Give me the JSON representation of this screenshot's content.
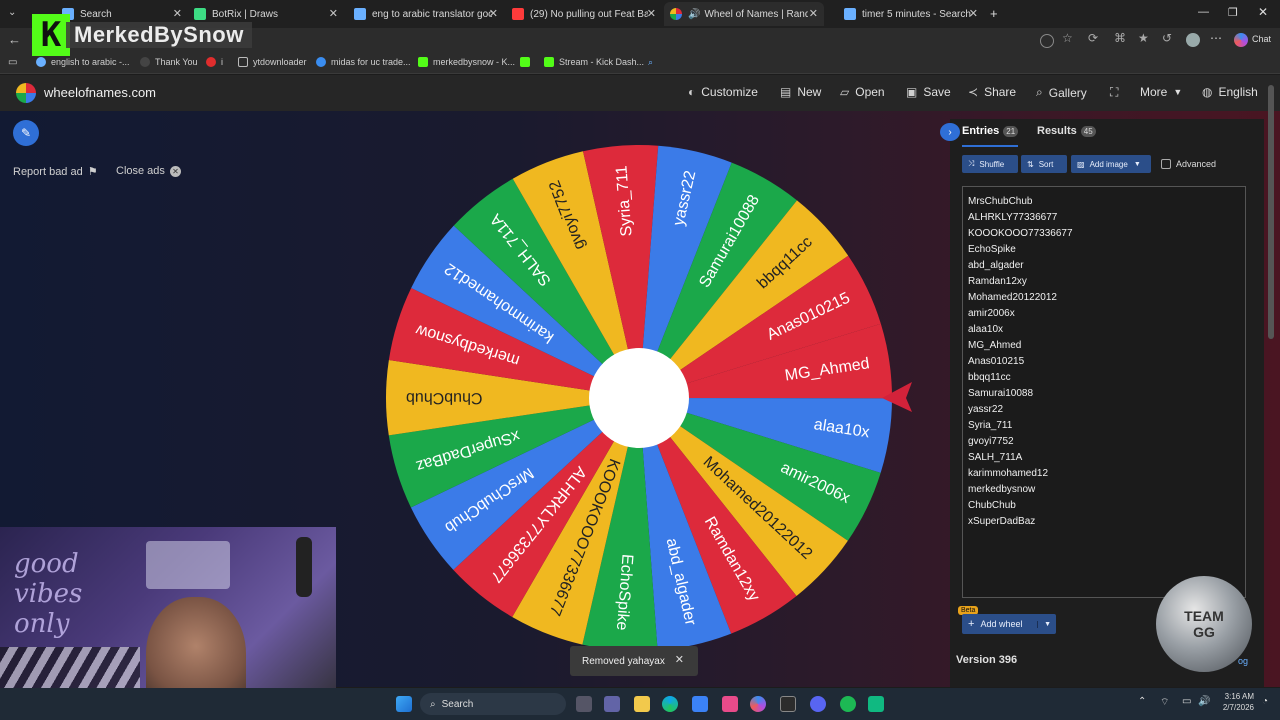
{
  "tabs": [
    {
      "label": "Search",
      "color": "#6ab0ff"
    },
    {
      "label": "BotRix | Draws",
      "color": "#3ddc84"
    },
    {
      "label": "eng to arabic translator google - S",
      "color": "#6ab0ff"
    },
    {
      "label": "(29) No pulling out Feat Baz",
      "color": "#ff3b3b"
    },
    {
      "label": "Wheel of Names | Random n",
      "color": "#4a8df6"
    },
    {
      "label": "timer 5 minutes - Search",
      "color": "#6ab0ff"
    }
  ],
  "overlay_logo": {
    "letter": "K",
    "text": "MerkedBySnow"
  },
  "browser": {
    "chat_label": "Chat"
  },
  "bookmarks": [
    "english to arabic -...",
    "Thank You",
    "i",
    "ytdownloader",
    "midas for uc trade...",
    "merkedbysnow - K...",
    "",
    "Stream - Kick Dash..."
  ],
  "site": {
    "name": "wheelofnames.com",
    "nav": [
      "Customize",
      "New",
      "Open",
      "Save",
      "Share",
      "Gallery",
      "",
      "More",
      "English"
    ]
  },
  "ads": {
    "report": "Report bad ad",
    "close": "Close ads"
  },
  "panel": {
    "tab_entries": "Entries",
    "entries_count": "21",
    "tab_results": "Results",
    "results_count": "45",
    "shuffle": "Shuffle",
    "sort": "Sort",
    "add_image": "Add image",
    "advanced": "Advanced",
    "add_wheel": "Add wheel",
    "beta": "Beta",
    "version": "Version 396",
    "log": "og"
  },
  "entries": [
    "MrsChubChub",
    "ALHRKLY77336677",
    "KOOOKOOO77336677",
    "EchoSpike",
    "abd_algader",
    "Ramdan12xy",
    "Mohamed20122012",
    "amir2006x",
    "alaa10x",
    "MG_Ahmed",
    "Anas010215",
    "bbqq11cc",
    "Samurai10088",
    "yassr22",
    "Syria_711",
    "gvoyi7752",
    "SALH_711A",
    "karimmohamed12",
    "merkedbysnow",
    "ChubChub",
    "xSuperDadBaz"
  ],
  "wheel_labels": [
    "MG_Ahmed",
    "alaa10x",
    "amir2006x",
    "Mohamed20122012",
    "Ramdan12xy",
    "abd_algader",
    "EchoSpike",
    "KOOOKOOO77336677",
    "ALHRKLY77336677",
    "MrsChubChub",
    "xSuperDadBaz",
    "ChubChub",
    "merkedbysnow",
    "karimmohamed12",
    "SALH_711A",
    "gvoyi7752",
    "Syria_711",
    "yassr22",
    "Samurai10088",
    "bbqq11cc",
    "Anas010215"
  ],
  "wheel_colors": [
    "#dd2a3b",
    "#3b7be8",
    "#1ba84a",
    "#f0b820"
  ],
  "toast": "Removed yahayax",
  "taskbar": {
    "search": "Search",
    "time": "3:16 AM",
    "date": "2/7/2026"
  },
  "webcam": {
    "sign": "good vibes only"
  },
  "badge": {
    "text": "TEAM GG"
  }
}
